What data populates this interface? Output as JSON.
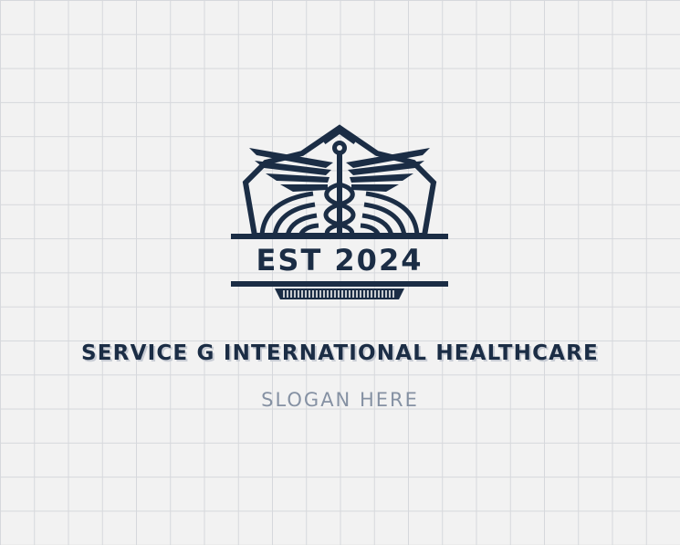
{
  "logo": {
    "established_label": "EST 2024",
    "company_name": "SERVICE G INTERNATIONAL HEALTHCARE",
    "slogan": "SLOGAN HERE",
    "emblem_icon": "caduceus-icon",
    "colors": {
      "primary": "#1b2d45",
      "slogan": "#8591a3",
      "background": "#f2f2f2",
      "grid": "#d6d8dc"
    }
  }
}
